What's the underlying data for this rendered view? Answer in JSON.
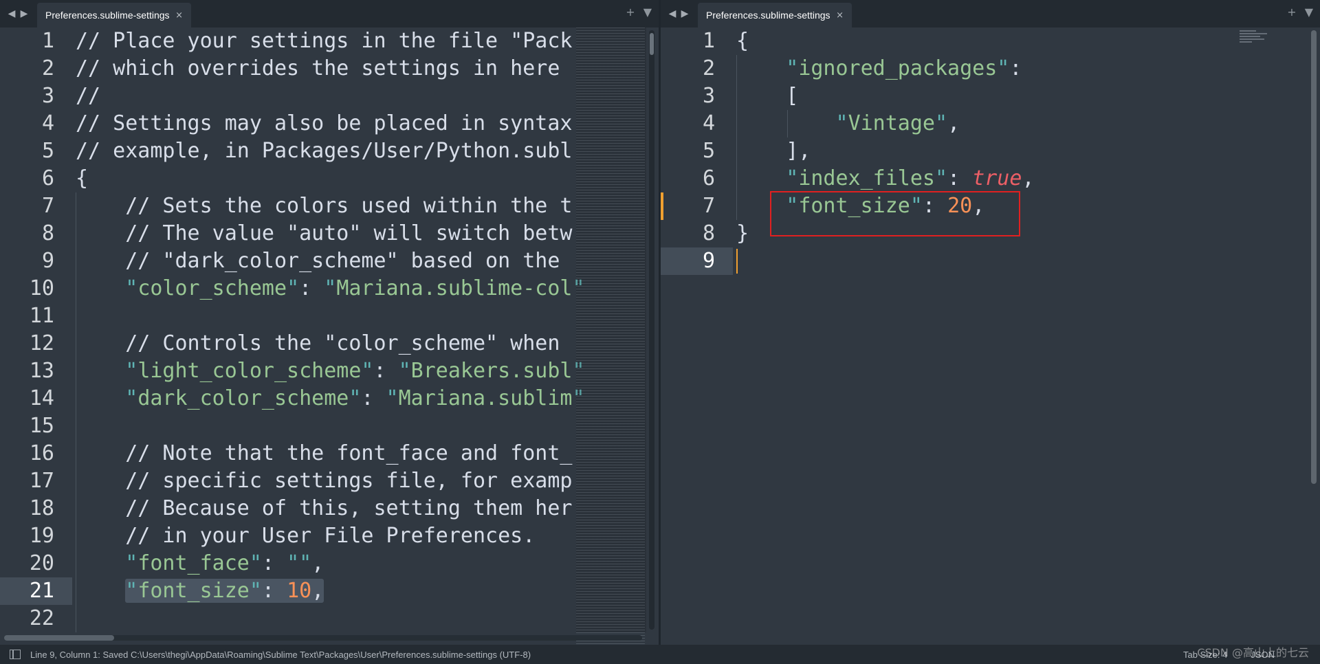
{
  "left_pane": {
    "tab_title": "Preferences.sublime-settings",
    "lines": [
      {
        "n": "1",
        "text": "// Place your settings in the file \"Pack"
      },
      {
        "n": "2",
        "text": "// which overrides the settings in here"
      },
      {
        "n": "3",
        "text": "//"
      },
      {
        "n": "4",
        "text": "// Settings may also be placed in syntax"
      },
      {
        "n": "5",
        "text": "// example, in Packages/User/Python.subl"
      },
      {
        "n": "6",
        "text": "{"
      },
      {
        "n": "7",
        "text": "    // Sets the colors used within the t"
      },
      {
        "n": "8",
        "text": "    // The value \"auto\" will switch betw"
      },
      {
        "n": "9",
        "text": "    // \"dark_color_scheme\" based on the"
      },
      {
        "n": "10",
        "key": "color_scheme",
        "value": "Mariana.sublime-col"
      },
      {
        "n": "11",
        "text": ""
      },
      {
        "n": "12",
        "text": "    // Controls the \"color_scheme\" when"
      },
      {
        "n": "13",
        "key": "light_color_scheme",
        "value": "Breakers.subl"
      },
      {
        "n": "14",
        "key": "dark_color_scheme",
        "value": "Mariana.sublim"
      },
      {
        "n": "15",
        "text": ""
      },
      {
        "n": "16",
        "text": "    // Note that the font_face and font_"
      },
      {
        "n": "17",
        "text": "    // specific settings file, for examp"
      },
      {
        "n": "18",
        "text": "    // Because of this, setting them her"
      },
      {
        "n": "19",
        "text": "    // in your User File Preferences."
      },
      {
        "n": "20",
        "key": "font_face",
        "value": ""
      },
      {
        "n": "21",
        "key": "font_size",
        "num": "10"
      },
      {
        "n": "22",
        "text": ""
      }
    ],
    "current_line": "21"
  },
  "right_pane": {
    "tab_title": "Preferences.sublime-settings",
    "line_numbers": [
      "1",
      "2",
      "3",
      "4",
      "5",
      "6",
      "7",
      "8",
      "9"
    ],
    "current_line": "9",
    "open_brace": "{",
    "close_brace": "}",
    "ignored_packages_key": "ignored_packages",
    "open_bracket": "[",
    "package_item": "Vintage",
    "close_bracket": "],",
    "index_files_key": "index_files",
    "index_files_value": "true",
    "font_size_key": "font_size",
    "font_size_value": "20"
  },
  "tab_controls": {
    "prev": "◀",
    "next": "▶",
    "add": "+",
    "menu": "▼",
    "close": "×"
  },
  "statusbar": {
    "message": "Line 9, Column 1: Saved C:\\Users\\thegi\\AppData\\Roaming\\Sublime Text\\Packages\\User\\Preferences.sublime-settings (UTF-8)",
    "tab_size": "Tab Size: 4",
    "syntax": "JSON"
  },
  "watermark": "CSDN @高山上的七云",
  "colors": {
    "background": "#303841",
    "string": "#99c794",
    "number": "#f99157",
    "keyword": "#ec5f66",
    "highlight_box": "#e02020"
  }
}
